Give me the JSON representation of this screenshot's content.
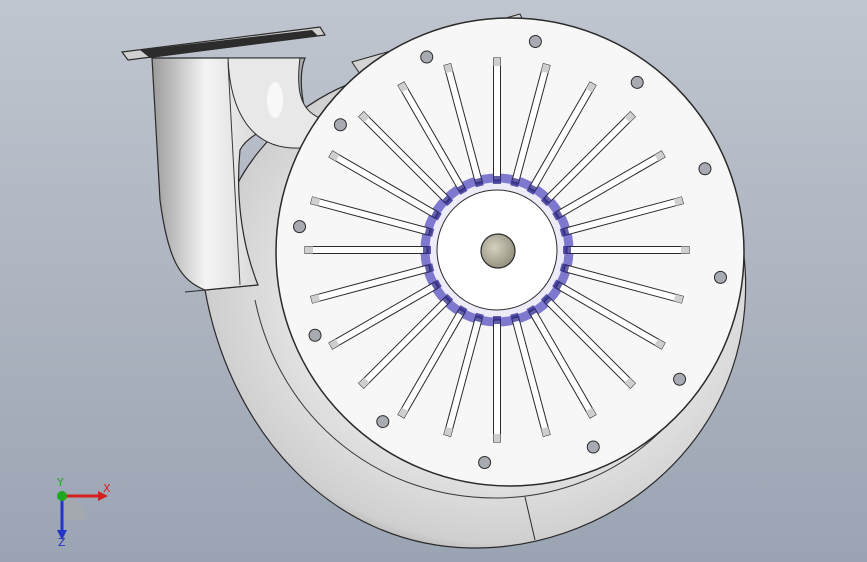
{
  "app": {
    "viewport_background": [
      "#c0c6cf",
      "#9aa4b3"
    ]
  },
  "model": {
    "name_icon": "centrifugal-blower-icon",
    "slot_count": 24,
    "bolt_hole_count": 12,
    "colors": {
      "body": "#dcdcdc",
      "face": "#f7f7f7",
      "edge": "#2a2a2a",
      "hub": "#b8b4a4",
      "highlight": "#8a84d8"
    }
  },
  "triad": {
    "x_label": "X",
    "y_label": "Y",
    "z_label": "Z",
    "x_color": "#d62020",
    "y_color": "#1ea81e",
    "z_color": "#2433c8"
  }
}
